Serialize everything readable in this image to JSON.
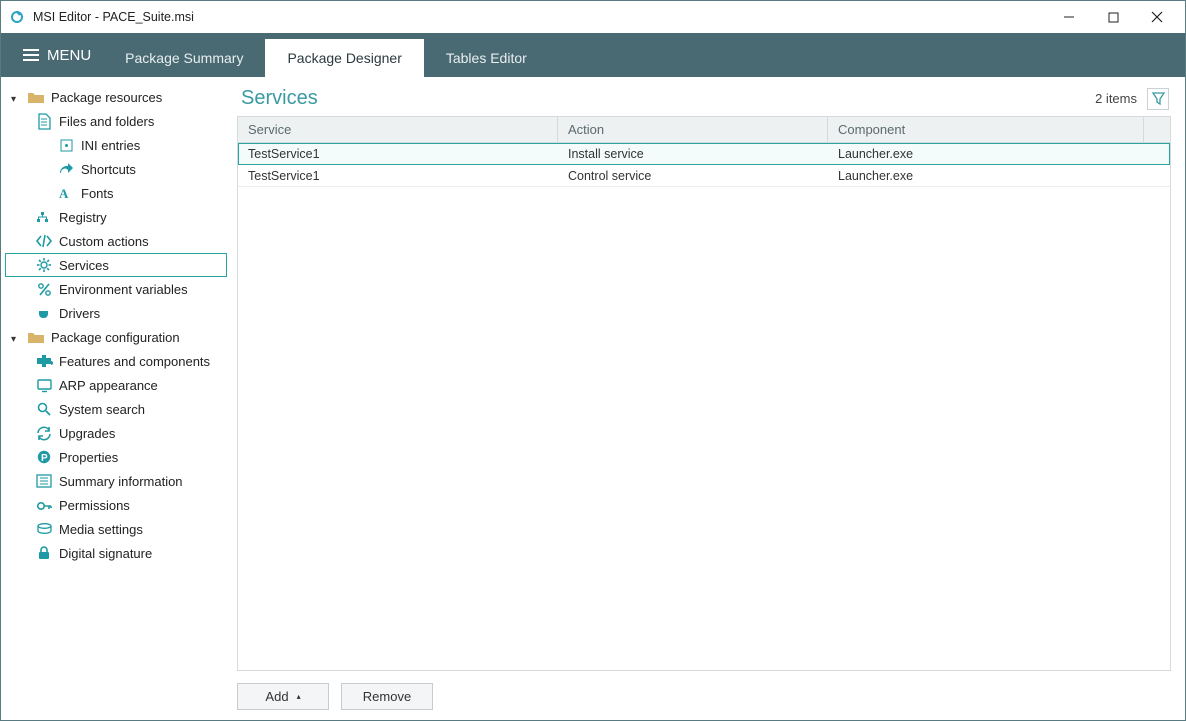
{
  "window": {
    "title": "MSI Editor - PACE_Suite.msi"
  },
  "menu": {
    "label": "MENU",
    "tabs": [
      "Package Summary",
      "Package Designer",
      "Tables Editor"
    ],
    "active_tab": 1
  },
  "sidebar": {
    "groups": [
      {
        "label": "Package resources",
        "children": [
          {
            "label": "Files and folders",
            "icon": "file-icon",
            "children": [
              {
                "label": "INI entries",
                "icon": "ini-icon"
              },
              {
                "label": "Shortcuts",
                "icon": "shortcut-icon"
              },
              {
                "label": "Fonts",
                "icon": "font-icon"
              }
            ]
          },
          {
            "label": "Registry",
            "icon": "registry-icon"
          },
          {
            "label": "Custom actions",
            "icon": "code-icon"
          },
          {
            "label": "Services",
            "icon": "gear-icon",
            "selected": true
          },
          {
            "label": "Environment variables",
            "icon": "percent-icon"
          },
          {
            "label": "Drivers",
            "icon": "plug-icon"
          }
        ]
      },
      {
        "label": "Package configuration",
        "children": [
          {
            "label": "Features and components",
            "icon": "puzzle-icon"
          },
          {
            "label": "ARP appearance",
            "icon": "monitor-icon"
          },
          {
            "label": "System search",
            "icon": "search-icon"
          },
          {
            "label": "Upgrades",
            "icon": "refresh-icon"
          },
          {
            "label": "Properties",
            "icon": "p-icon"
          },
          {
            "label": "Summary information",
            "icon": "list-icon"
          },
          {
            "label": "Permissions",
            "icon": "key-icon"
          },
          {
            "label": "Media settings",
            "icon": "disk-icon"
          },
          {
            "label": "Digital signature",
            "icon": "lock-icon"
          }
        ]
      }
    ]
  },
  "content": {
    "title": "Services",
    "count_label": "2 items",
    "columns": [
      "Service",
      "Action",
      "Component"
    ],
    "rows": [
      {
        "service": "TestService1",
        "action": "Install service",
        "component": "Launcher.exe",
        "selected": true
      },
      {
        "service": "TestService1",
        "action": "Control service",
        "component": "Launcher.exe"
      }
    ],
    "buttons": {
      "add": "Add",
      "remove": "Remove"
    }
  }
}
